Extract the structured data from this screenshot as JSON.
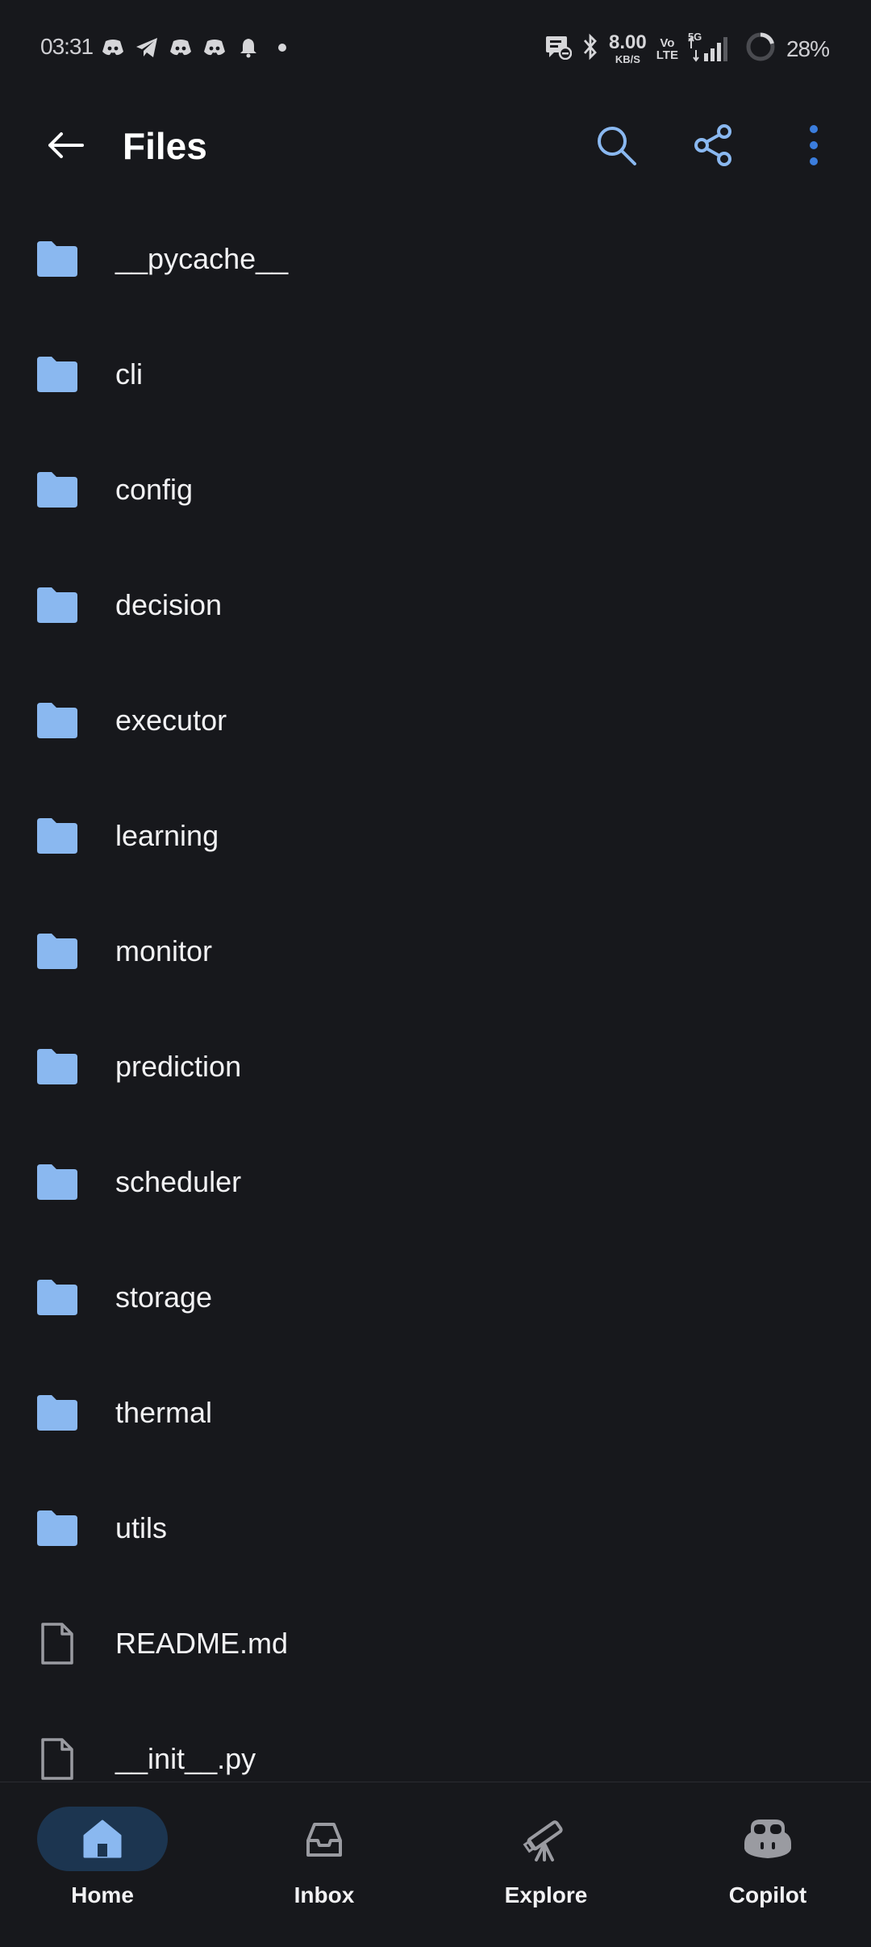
{
  "status_bar": {
    "time": "03:31",
    "left_icons": [
      "discord-icon",
      "telegram-icon",
      "discord-icon",
      "discord-icon",
      "bell-icon",
      "dot-icon"
    ],
    "net_speed_value": "8.00",
    "net_speed_unit": "KB/S",
    "volte_top": "Vo",
    "volte_bottom": "LTE",
    "network_type": "5G",
    "battery_percent": "28%"
  },
  "app_bar": {
    "title": "Files",
    "accent_color": "#8ab8f0"
  },
  "files": [
    {
      "name": "__pycache__",
      "type": "folder"
    },
    {
      "name": "cli",
      "type": "folder"
    },
    {
      "name": "config",
      "type": "folder"
    },
    {
      "name": "decision",
      "type": "folder"
    },
    {
      "name": "executor",
      "type": "folder"
    },
    {
      "name": "learning",
      "type": "folder"
    },
    {
      "name": "monitor",
      "type": "folder"
    },
    {
      "name": "prediction",
      "type": "folder"
    },
    {
      "name": "scheduler",
      "type": "folder"
    },
    {
      "name": "storage",
      "type": "folder"
    },
    {
      "name": "thermal",
      "type": "folder"
    },
    {
      "name": "utils",
      "type": "folder"
    },
    {
      "name": "README.md",
      "type": "file"
    },
    {
      "name": "__init__.py",
      "type": "file"
    }
  ],
  "bottom_nav": {
    "items": [
      {
        "label": "Home",
        "icon": "home-icon",
        "active": true
      },
      {
        "label": "Inbox",
        "icon": "inbox-icon",
        "active": false
      },
      {
        "label": "Explore",
        "icon": "telescope-icon",
        "active": false
      },
      {
        "label": "Copilot",
        "icon": "copilot-icon",
        "active": false
      }
    ]
  },
  "colors": {
    "background": "#17181c",
    "folder": "#8ab8f0",
    "file_icon": "#9a9ba1",
    "active_pill": "#1c3550",
    "more_dots": "#3b7ddd"
  }
}
